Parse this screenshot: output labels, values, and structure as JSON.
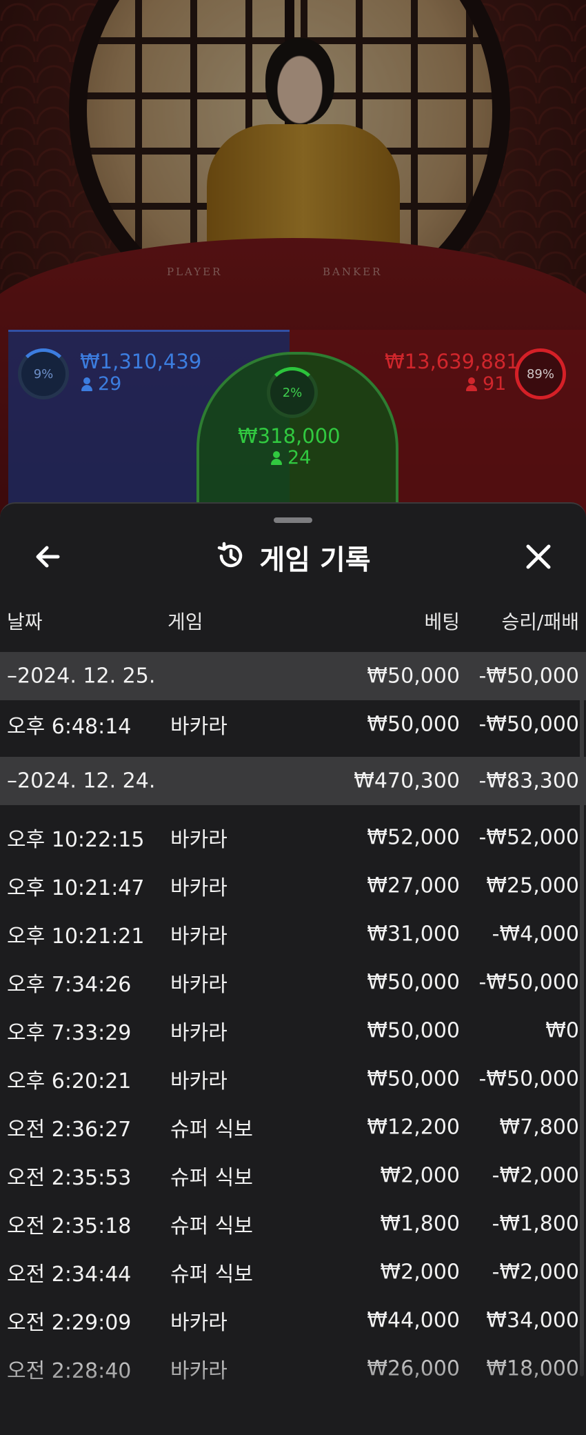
{
  "video": {
    "table_labels": {
      "player": "PLAYER",
      "banker": "BANKER"
    }
  },
  "bets": {
    "player": {
      "percent_label": "9%",
      "percent_value": 9,
      "amount": "₩1,310,439",
      "count": "29",
      "color": "#3c7ddf"
    },
    "tie": {
      "percent_label": "2%",
      "percent_value": 2,
      "amount": "₩318,000",
      "count": "24",
      "color": "#31c940"
    },
    "banker": {
      "percent_label": "89%",
      "percent_value": 89,
      "amount": "₩13,639,881",
      "count": "91",
      "color": "#d0262c"
    }
  },
  "history": {
    "title": "게임 기록",
    "back_icon": "arrow-left-icon",
    "title_icon": "history-icon",
    "close_icon": "close-icon",
    "columns": {
      "date": "날짜",
      "game": "게임",
      "bet": "베팅",
      "win_loss": "승리/패배"
    },
    "groups": [
      {
        "date": "–2024. 12. 25.",
        "bet": "₩50,000",
        "win_loss": "-₩50,000",
        "rows": [
          {
            "time": "오후 6:48:14",
            "game": "바카라",
            "bet": "₩50,000",
            "win_loss": "-₩50,000"
          }
        ]
      },
      {
        "date": "–2024. 12. 24.",
        "bet": "₩470,300",
        "win_loss": "-₩83,300",
        "rows": [
          {
            "time": "오후 10:22:15",
            "game": "바카라",
            "bet": "₩52,000",
            "win_loss": "-₩52,000"
          },
          {
            "time": "오후 10:21:47",
            "game": "바카라",
            "bet": "₩27,000",
            "win_loss": "₩25,000"
          },
          {
            "time": "오후 10:21:21",
            "game": "바카라",
            "bet": "₩31,000",
            "win_loss": "-₩4,000"
          },
          {
            "time": "오후 7:34:26",
            "game": "바카라",
            "bet": "₩50,000",
            "win_loss": "-₩50,000"
          },
          {
            "time": "오후 7:33:29",
            "game": "바카라",
            "bet": "₩50,000",
            "win_loss": "₩0"
          },
          {
            "time": "오후 6:20:21",
            "game": "바카라",
            "bet": "₩50,000",
            "win_loss": "-₩50,000"
          },
          {
            "time": "오전 2:36:27",
            "game": "슈퍼 식보",
            "bet": "₩12,200",
            "win_loss": "₩7,800"
          },
          {
            "time": "오전 2:35:53",
            "game": "슈퍼 식보",
            "bet": "₩2,000",
            "win_loss": "-₩2,000"
          },
          {
            "time": "오전 2:35:18",
            "game": "슈퍼 식보",
            "bet": "₩1,800",
            "win_loss": "-₩1,800"
          },
          {
            "time": "오전 2:34:44",
            "game": "슈퍼 식보",
            "bet": "₩2,000",
            "win_loss": "-₩2,000"
          },
          {
            "time": "오전 2:29:09",
            "game": "바카라",
            "bet": "₩44,000",
            "win_loss": "₩34,000"
          },
          {
            "time": "오전 2:28:40",
            "game": "바카라",
            "bet": "₩26,000",
            "win_loss": "₩18,000"
          }
        ]
      }
    ]
  }
}
